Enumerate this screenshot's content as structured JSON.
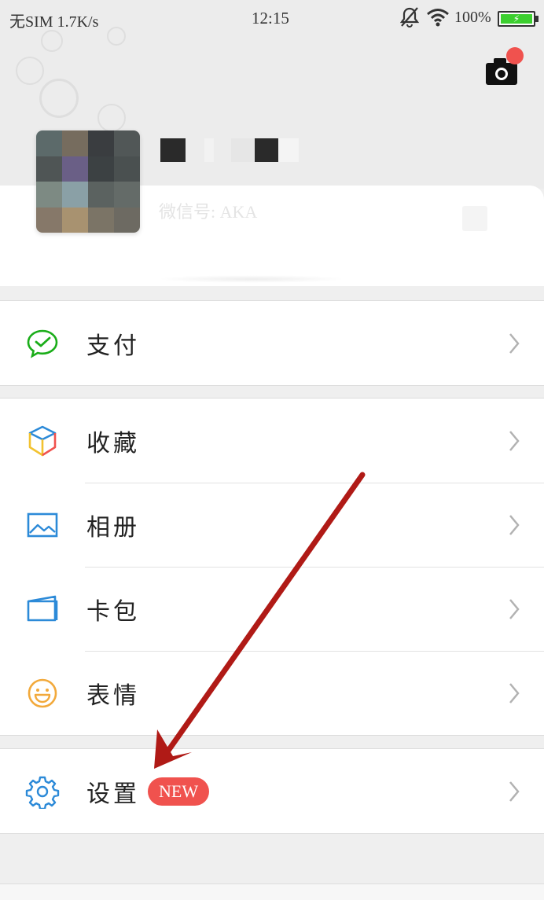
{
  "status_bar": {
    "carrier": "无SIM 1.7K/s",
    "time": "12:15",
    "battery_percent": "100%",
    "battery_level": 1.0,
    "icons": [
      "mute-icon",
      "wifi-icon",
      "battery-icon"
    ]
  },
  "header": {
    "camera_icon": "camera-icon",
    "has_notification_dot": true
  },
  "profile": {
    "wechat_id": "微信号: AKA"
  },
  "menu": {
    "sections": [
      {
        "items": [
          {
            "label": "支付",
            "icon": "pay-icon"
          }
        ]
      },
      {
        "items": [
          {
            "label": "收藏",
            "icon": "favorites-icon"
          },
          {
            "label": "相册",
            "icon": "album-icon"
          },
          {
            "label": "卡包",
            "icon": "card-wallet-icon"
          },
          {
            "label": "表情",
            "icon": "emoji-icon"
          }
        ]
      },
      {
        "items": [
          {
            "label": "设置",
            "icon": "settings-icon",
            "badge": "NEW"
          }
        ]
      }
    ]
  },
  "colors": {
    "accent_red": "#f0524e",
    "pay_green": "#1aad19",
    "icon_blue": "#2c8ad8",
    "emoji_orange": "#f2a93b"
  }
}
